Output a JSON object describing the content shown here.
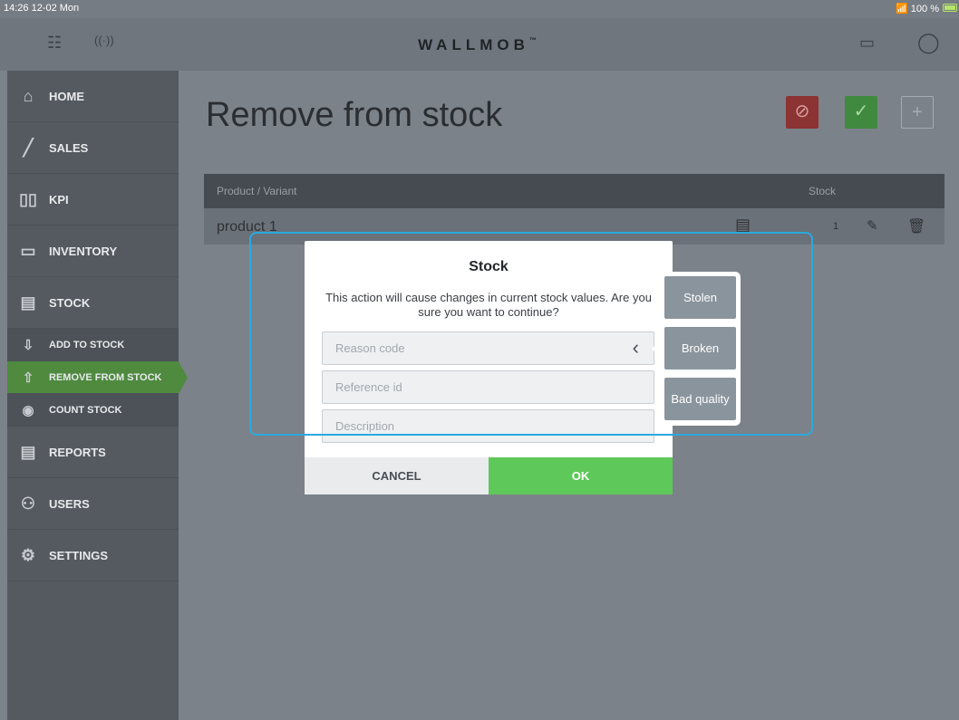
{
  "status": {
    "time": "14:26  12-02 Mon",
    "right": "100 %"
  },
  "topbar": {
    "logo": "WALLMOB",
    "logo_tm": "™"
  },
  "sidebar": {
    "items": [
      {
        "label": "HOME",
        "icon": "home-icon",
        "glyph": "⌂"
      },
      {
        "label": "SALES",
        "icon": "sales-chart-icon",
        "glyph": "📶"
      },
      {
        "label": "KPI",
        "icon": "kpi-bars-icon",
        "glyph": "▯"
      },
      {
        "label": "INVENTORY",
        "icon": "inventory-box-icon",
        "glyph": "▭"
      },
      {
        "label": "STOCK",
        "icon": "stock-box-icon",
        "glyph": "▤"
      },
      {
        "label": "ADD TO STOCK",
        "icon": "add-to-stock-icon",
        "glyph": "⇩"
      },
      {
        "label": "REMOVE FROM STOCK",
        "icon": "remove-from-stock-icon",
        "glyph": "⇧"
      },
      {
        "label": "COUNT STOCK",
        "icon": "count-stock-icon",
        "glyph": "◉"
      },
      {
        "label": "REPORTS",
        "icon": "reports-icon",
        "glyph": "▤"
      },
      {
        "label": "USERS",
        "icon": "users-icon",
        "glyph": "⚇"
      },
      {
        "label": "SETTINGS",
        "icon": "settings-gear-icon",
        "glyph": "⚙"
      }
    ]
  },
  "main": {
    "title": "Remove from stock",
    "buttons": {
      "cancel_glyph": "⊘",
      "confirm_glyph": "✓",
      "add_glyph": "+"
    },
    "table": {
      "headers": {
        "product": "Product / Variant",
        "stock": "Stock"
      },
      "rows": [
        {
          "product": "product 1",
          "stock": "1"
        }
      ]
    }
  },
  "modal": {
    "title": "Stock",
    "message": "This action will cause changes in current stock values. Are you sure you want to continue?",
    "reason_placeholder": "Reason code",
    "reference_placeholder": "Reference id",
    "description_placeholder": "Description",
    "cancel_label": "CANCEL",
    "ok_label": "OK"
  },
  "popover": {
    "options": [
      "Stolen",
      "Broken",
      "Bad quality"
    ]
  },
  "colors": {
    "active": "#4f8a3f",
    "ok": "#5fc85a",
    "highlight": "#2aa9e0"
  }
}
